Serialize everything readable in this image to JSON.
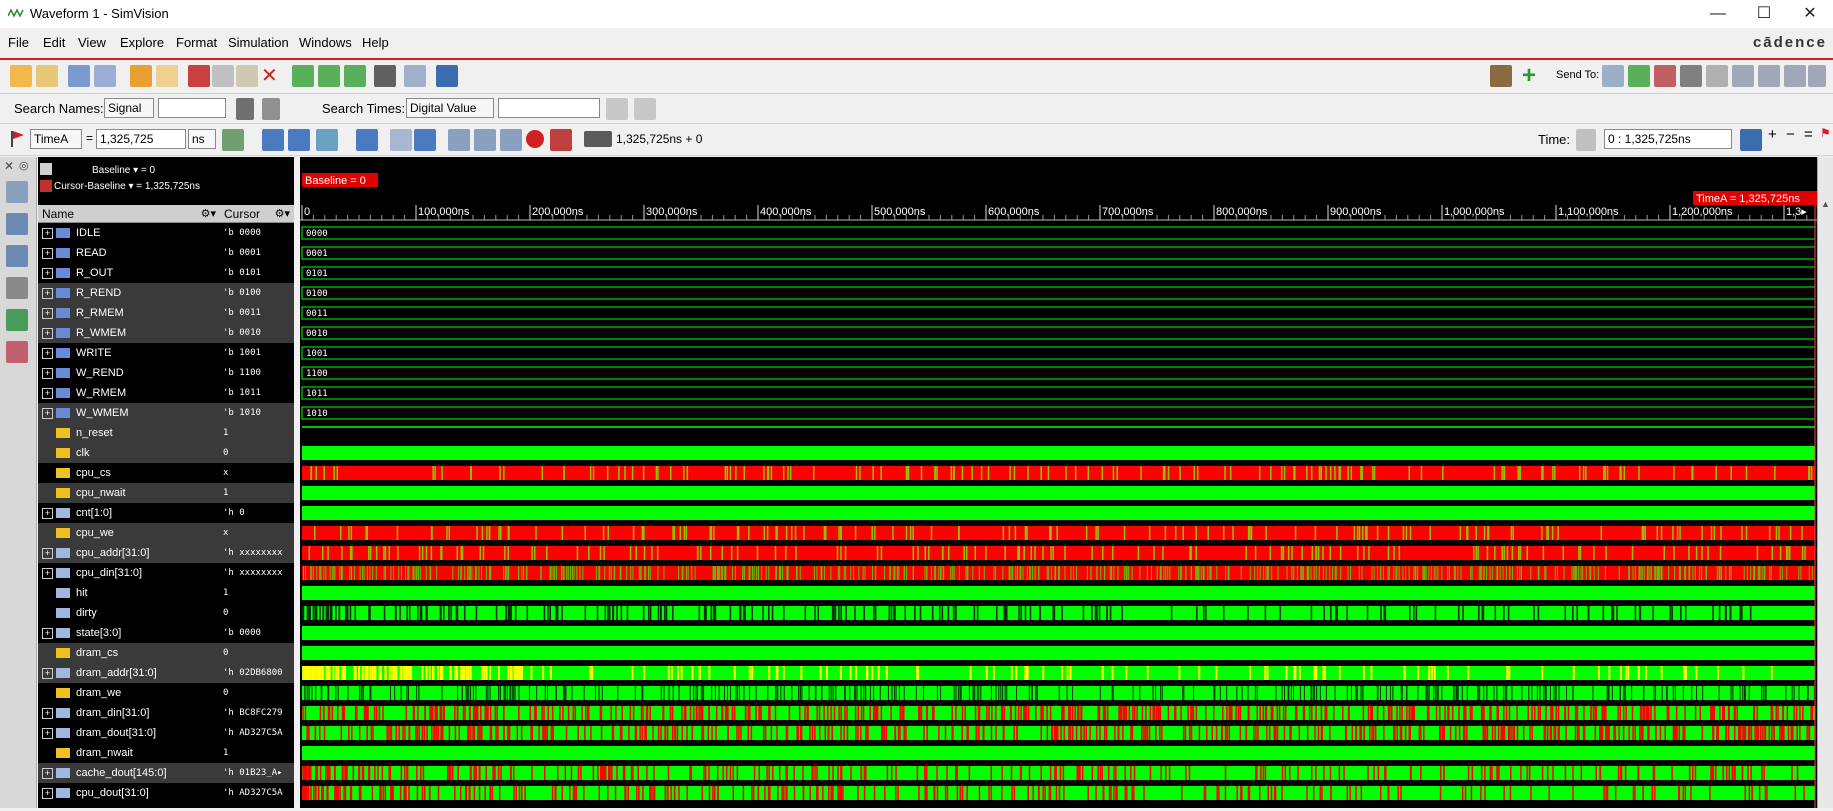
{
  "window": {
    "title": "Waveform 1 - SimVision",
    "min": "—",
    "max": "☐",
    "close": "✕"
  },
  "menu": [
    "File",
    "Edit",
    "View",
    "Explore",
    "Format",
    "Simulation",
    "Windows",
    "Help"
  ],
  "brand": "cādence",
  "toolbar1": {
    "send_to_label": "Send To:"
  },
  "toolbar2": {
    "search_names_label": "Search Names:",
    "search_names_type": "Signal",
    "search_times_label": "Search Times:",
    "search_times_type": "Digital Value"
  },
  "toolbar3": {
    "cursor_name": "TimeA",
    "equals": "=",
    "cursor_value": "1,325,725",
    "units": "ns",
    "sim_time": "1,325,725ns + 0",
    "time_label": "Time:",
    "time_range": "0 : 1,325,725ns"
  },
  "panel": {
    "baseline_label": "Baseline ▾ = 0",
    "cursor_baseline_label": "Cursor-Baseline ▾ = 1,325,725ns",
    "name_header": "Name",
    "cursor_header": "Cursor"
  },
  "markers": {
    "baseline": "Baseline = 0",
    "timea": "TimeA = 1,325,725ns"
  },
  "ruler": [
    "0",
    "100,000ns",
    "200,000ns",
    "300,000ns",
    "400,000ns",
    "500,000ns",
    "600,000ns",
    "700,000ns",
    "800,000ns",
    "900,000ns",
    "1,000,000ns",
    "1,100,000ns",
    "1,200,000ns",
    "1,3▸"
  ],
  "signals": [
    {
      "name": "IDLE",
      "cursor": "'b 0000",
      "expand": true,
      "kind": "param",
      "wave": "const",
      "val": "0000"
    },
    {
      "name": "READ",
      "cursor": "'b 0001",
      "expand": true,
      "kind": "param",
      "wave": "const",
      "val": "0001"
    },
    {
      "name": "R_OUT",
      "cursor": "'b 0101",
      "expand": true,
      "kind": "param",
      "wave": "const",
      "val": "0101"
    },
    {
      "name": "R_REND",
      "cursor": "'b 0100",
      "expand": true,
      "kind": "param",
      "wave": "const",
      "val": "0100"
    },
    {
      "name": "R_RMEM",
      "cursor": "'b 0011",
      "expand": true,
      "kind": "param",
      "wave": "const",
      "val": "0011"
    },
    {
      "name": "R_WMEM",
      "cursor": "'b 0010",
      "expand": true,
      "kind": "param",
      "wave": "const",
      "val": "0010"
    },
    {
      "name": "WRITE",
      "cursor": "'b 1001",
      "expand": true,
      "kind": "param",
      "wave": "const",
      "val": "1001"
    },
    {
      "name": "W_REND",
      "cursor": "'b 1100",
      "expand": true,
      "kind": "param",
      "wave": "const",
      "val": "1100"
    },
    {
      "name": "W_RMEM",
      "cursor": "'b 1011",
      "expand": true,
      "kind": "param",
      "wave": "const",
      "val": "1011"
    },
    {
      "name": "W_WMEM",
      "cursor": "'b 1010",
      "expand": true,
      "kind": "param",
      "wave": "const",
      "val": "1010"
    },
    {
      "name": "n_reset",
      "cursor": "1",
      "expand": false,
      "kind": "in",
      "wave": "line",
      "val": ""
    },
    {
      "name": "clk",
      "cursor": "0",
      "expand": false,
      "kind": "in",
      "wave": "solid",
      "val": ""
    },
    {
      "name": "cpu_cs",
      "cursor": "x",
      "expand": false,
      "kind": "in",
      "wave": "redbusy",
      "val": ""
    },
    {
      "name": "cpu_nwait",
      "cursor": "1",
      "expand": false,
      "kind": "out",
      "wave": "solid",
      "val": ""
    },
    {
      "name": "cnt[1:0]",
      "cursor": "'h 0",
      "expand": true,
      "kind": "reg",
      "wave": "solid",
      "val": ""
    },
    {
      "name": "cpu_we",
      "cursor": "x",
      "expand": false,
      "kind": "in",
      "wave": "redbusy",
      "val": ""
    },
    {
      "name": "cpu_addr[31:0]",
      "cursor": "'h xxxxxxxx",
      "expand": true,
      "kind": "bus",
      "wave": "redbusy",
      "val": ""
    },
    {
      "name": "cpu_din[31:0]",
      "cursor": "'h xxxxxxxx",
      "expand": true,
      "kind": "bus",
      "wave": "redbusy2",
      "val": ""
    },
    {
      "name": "hit",
      "cursor": "1",
      "expand": false,
      "kind": "wire",
      "wave": "solid",
      "val": ""
    },
    {
      "name": "dirty",
      "cursor": "0",
      "expand": false,
      "kind": "wire",
      "wave": "greenbusy",
      "val": ""
    },
    {
      "name": "state[3:0]",
      "cursor": "'b 0000",
      "expand": true,
      "kind": "reg",
      "wave": "solid",
      "val": ""
    },
    {
      "name": "dram_cs",
      "cursor": "0",
      "expand": false,
      "kind": "out",
      "wave": "solid",
      "val": ""
    },
    {
      "name": "dram_addr[31:0]",
      "cursor": "'h 02DB6800",
      "expand": true,
      "kind": "bus",
      "wave": "yellowbusy",
      "val": ""
    },
    {
      "name": "dram_we",
      "cursor": "0",
      "expand": false,
      "kind": "out",
      "wave": "greenbusy2",
      "val": ""
    },
    {
      "name": "dram_din[31:0]",
      "cursor": "'h BC8FC279",
      "expand": true,
      "kind": "bus",
      "wave": "mixbusy",
      "val": ""
    },
    {
      "name": "dram_dout[31:0]",
      "cursor": "'h AD327C5A",
      "expand": true,
      "kind": "bus",
      "wave": "mixbusy",
      "val": ""
    },
    {
      "name": "dram_nwait",
      "cursor": "1",
      "expand": false,
      "kind": "in",
      "wave": "solid",
      "val": ""
    },
    {
      "name": "cache_dout[145:0]",
      "cursor": "'h 01B23_A▸",
      "expand": true,
      "kind": "bus",
      "wave": "mixbusy2",
      "val": ""
    },
    {
      "name": "cpu_dout[31:0]",
      "cursor": "'h AD327C5A",
      "expand": true,
      "kind": "bus",
      "wave": "mixbusy2",
      "val": ""
    }
  ],
  "colors": {
    "green": "#00ff00",
    "red": "#ff0000",
    "yellow": "#ffff00",
    "bg": "#000000",
    "grid": "#2a2a2a"
  }
}
